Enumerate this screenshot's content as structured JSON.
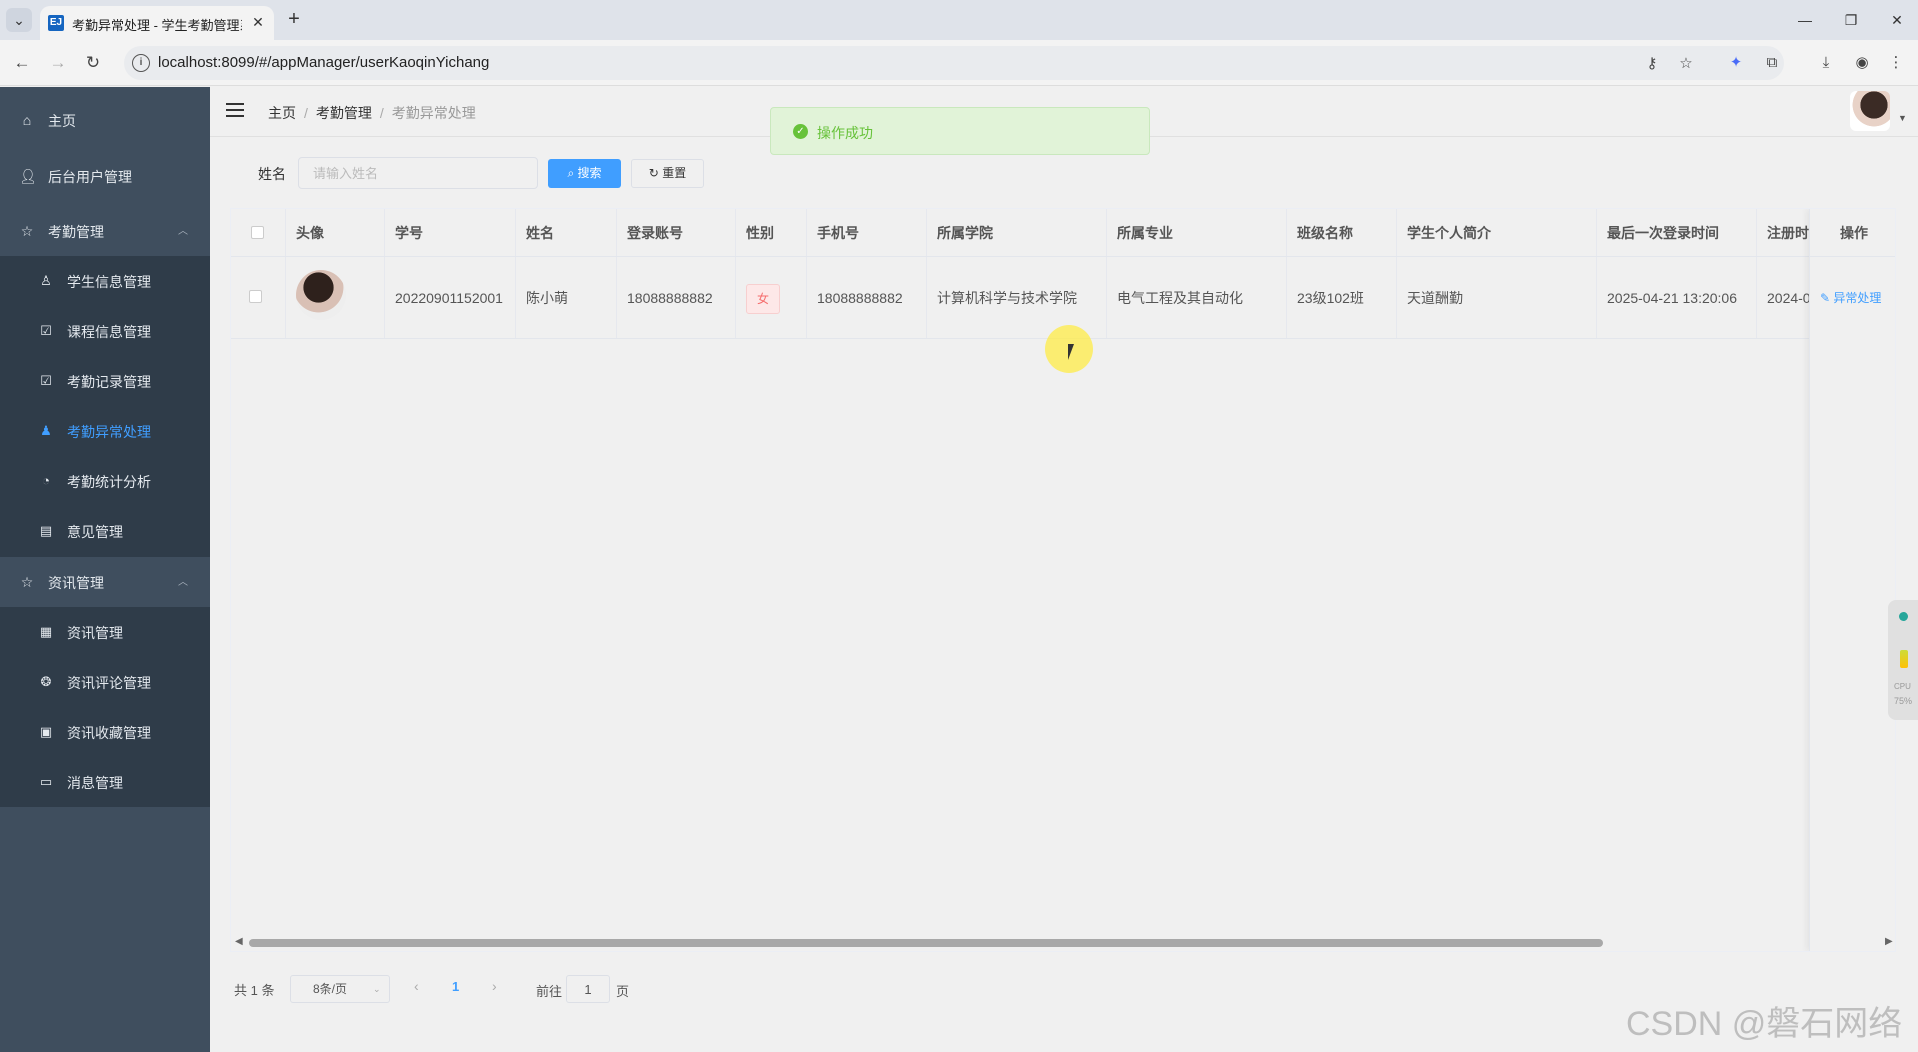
{
  "browser": {
    "tab_title": "考勤异常处理 - 学生考勤管理系",
    "favicon_text": "EJ",
    "url": "localhost:8099/#/appManager/userKaoqinYichang"
  },
  "sidebar": {
    "items": [
      {
        "label": "主页",
        "icon": "home-icon"
      },
      {
        "label": "后台用户管理",
        "icon": "user-icon"
      },
      {
        "label": "考勤管理",
        "icon": "star-icon",
        "expanded": true,
        "children": [
          {
            "label": "学生信息管理",
            "icon": "user-outline-icon"
          },
          {
            "label": "课程信息管理",
            "icon": "clipboard-check-icon"
          },
          {
            "label": "考勤记录管理",
            "icon": "clipboard-check-icon"
          },
          {
            "label": "考勤异常处理",
            "icon": "user-filled-icon",
            "active": true
          },
          {
            "label": "考勤统计分析",
            "icon": "pie-chart-icon"
          },
          {
            "label": "意见管理",
            "icon": "clipboard-icon"
          }
        ]
      },
      {
        "label": "资讯管理",
        "icon": "star-icon",
        "expanded": true,
        "children": [
          {
            "label": "资讯管理",
            "icon": "document-icon"
          },
          {
            "label": "资讯评论管理",
            "icon": "wheel-icon"
          },
          {
            "label": "资讯收藏管理",
            "icon": "briefcase-icon"
          },
          {
            "label": "消息管理",
            "icon": "chat-icon"
          }
        ]
      }
    ]
  },
  "header": {
    "breadcrumb": [
      "主页",
      "考勤管理",
      "考勤异常处理"
    ]
  },
  "toast": {
    "message": "操作成功"
  },
  "search": {
    "label": "姓名",
    "placeholder": "请输入姓名",
    "search_button": "搜索",
    "reset_button": "重置"
  },
  "table": {
    "columns": [
      "头像",
      "学号",
      "姓名",
      "登录账号",
      "性别",
      "手机号",
      "所属学院",
      "所属专业",
      "班级名称",
      "学生个人简介",
      "最后一次登录时间",
      "注册时间",
      "操作"
    ],
    "rows": [
      {
        "student_id": "20220901152001",
        "name": "陈小萌",
        "account": "18088888882",
        "gender": "女",
        "phone": "18088888882",
        "college": "计算机科学与技术学院",
        "major": "电气工程及其自动化",
        "class_name": "23级102班",
        "intro": "天道酬勤",
        "last_login": "2025-04-21 13:20:06",
        "register_time": "2024-0",
        "action": "异常处理"
      }
    ]
  },
  "pagination": {
    "total": "共 1 条",
    "page_size": "8条/页",
    "current_page": "1",
    "goto_label": "前往",
    "goto_value": "1",
    "page_suffix": "页"
  },
  "widget": {
    "cpu_label": "CPU",
    "cpu_value": "75%"
  },
  "watermark": "CSDN @磐石网络",
  "colors": {
    "sidebar_bg": "#3f4e5e",
    "submenu_bg": "#2f3c49",
    "accent": "#409eff",
    "success": "#67c23a",
    "danger": "#f56c6c"
  }
}
